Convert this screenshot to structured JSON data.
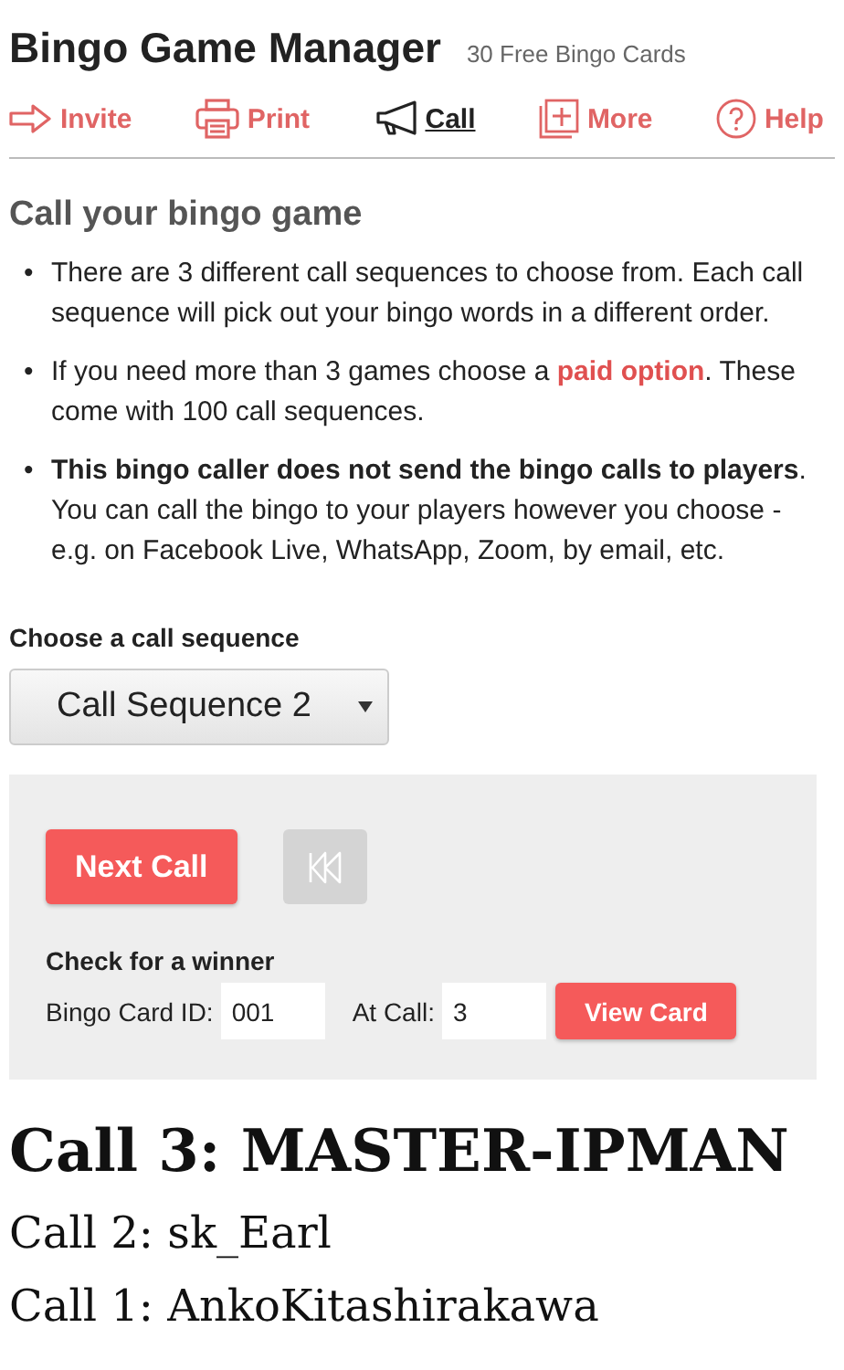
{
  "header": {
    "title": "Bingo Game Manager",
    "subtitle": "30 Free Bingo Cards"
  },
  "nav": [
    {
      "label": "Invite",
      "kind": "invite",
      "selected": false
    },
    {
      "label": "Print",
      "kind": "print",
      "selected": false
    },
    {
      "label": "Call",
      "kind": "call",
      "selected": true
    },
    {
      "label": "More",
      "kind": "more",
      "selected": false
    },
    {
      "label": "Help",
      "kind": "help",
      "selected": false
    }
  ],
  "heading": "Call your bingo game",
  "bullets": [
    {
      "marker": "•",
      "text": "There are 3 different call sequences to choose from. Each call sequence will pick out your bingo words in a different order."
    },
    {
      "marker": "•",
      "text": "If you need more than 3 games choose a ",
      "link": "paid option",
      "after": ". These come with 100 call sequences."
    },
    {
      "marker": "•",
      "text": "**This bingo caller does not send the bingo calls to players**. You can call the bingo to your players however you choose - e.g. on Facebook Live, WhatsApp, Zoom, by email, etc."
    }
  ],
  "sequence": {
    "label": "Choose a call sequence",
    "value": "Call Sequence 2"
  },
  "controls": {
    "next_button": "Next Call",
    "rewind_disabled": true,
    "check_heading": "Check for a winner",
    "card_id_label": "Bingo Card ID:",
    "card_id": "001",
    "at_call_label": "At Call:",
    "at_call": "3",
    "view_button": "View Card"
  },
  "calls": [
    {
      "text": "Call 3: MASTER-IPMAN",
      "kind": "current"
    },
    {
      "text": "Call 2: sk_Earl",
      "kind": "previous"
    },
    {
      "text": "Call 1: AnkoKitashirakawa",
      "kind": "previous"
    }
  ]
}
